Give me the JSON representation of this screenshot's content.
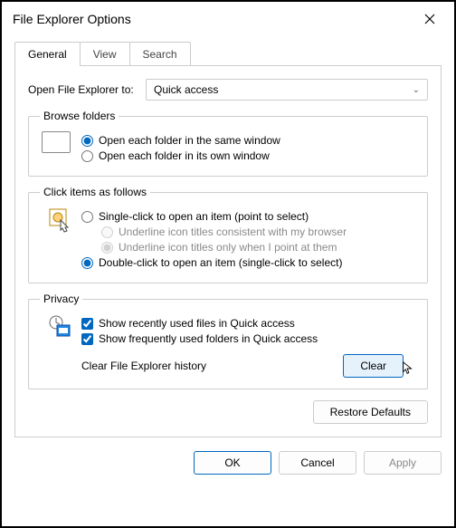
{
  "window": {
    "title": "File Explorer Options"
  },
  "tabs": {
    "general": "General",
    "view": "View",
    "search": "Search"
  },
  "open_to": {
    "label": "Open File Explorer to:",
    "value": "Quick access"
  },
  "browse": {
    "legend": "Browse folders",
    "same": "Open each folder in the same window",
    "own": "Open each folder in its own window"
  },
  "click": {
    "legend": "Click items as follows",
    "single": "Single-click to open an item (point to select)",
    "ul_browser": "Underline icon titles consistent with my browser",
    "ul_point": "Underline icon titles only when I point at them",
    "double": "Double-click to open an item (single-click to select)"
  },
  "privacy": {
    "legend": "Privacy",
    "recent": "Show recently used files in Quick access",
    "frequent": "Show frequently used folders in Quick access",
    "clear_label": "Clear File Explorer history",
    "clear_btn": "Clear"
  },
  "restore": "Restore Defaults",
  "footer": {
    "ok": "OK",
    "cancel": "Cancel",
    "apply": "Apply"
  }
}
